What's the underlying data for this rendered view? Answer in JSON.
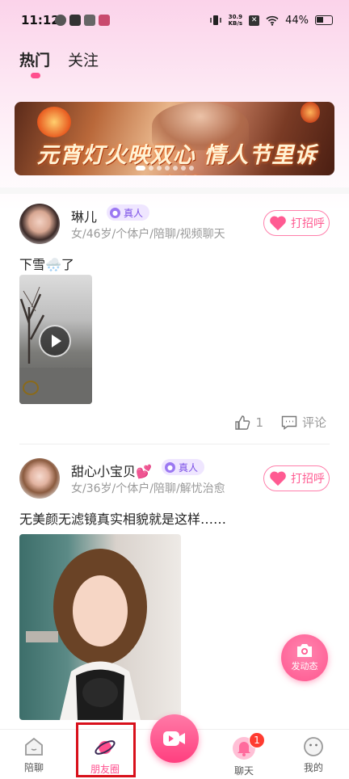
{
  "status_bar": {
    "time": "11:12",
    "net_speed": "30.9",
    "net_unit": "KB/s",
    "battery": "44%"
  },
  "tabs": [
    {
      "label": "热门",
      "active": true
    },
    {
      "label": "关注",
      "active": false
    }
  ],
  "banner": {
    "slogan": "元宵灯火映双心 情人节里诉衷情"
  },
  "posts": [
    {
      "name": "琳儿",
      "badge": "真人",
      "meta": "女/46岁/个体户/陪聊/视频聊天",
      "greet": "打招呼",
      "text": "下雪🌨️了",
      "media_type": "video",
      "likes": "1",
      "comment": "评论"
    },
    {
      "name": "甜心小宝贝💕",
      "badge": "真人",
      "meta": "女/36岁/个体户/陪聊/解忧治愈",
      "greet": "打招呼",
      "text": "无美颜无滤镜真实相貌就是这样……",
      "media_type": "photo"
    }
  ],
  "fab": {
    "label": "发动态",
    "icon": "camera-icon"
  },
  "bottom_nav": [
    {
      "label": "陪聊",
      "icon": "home-icon",
      "active": false
    },
    {
      "label": "朋友圈",
      "icon": "planet-icon",
      "active": true
    },
    {
      "label": "",
      "icon": "video-camera-icon",
      "active": false
    },
    {
      "label": "聊天",
      "icon": "bell-icon",
      "active": false,
      "badge": "1"
    },
    {
      "label": "我的",
      "icon": "smile-face-icon",
      "active": false
    }
  ],
  "colors": {
    "accent": "#ff4f8e",
    "badge_purple": "#7a4ee6",
    "highlight_red": "#d8101b"
  }
}
